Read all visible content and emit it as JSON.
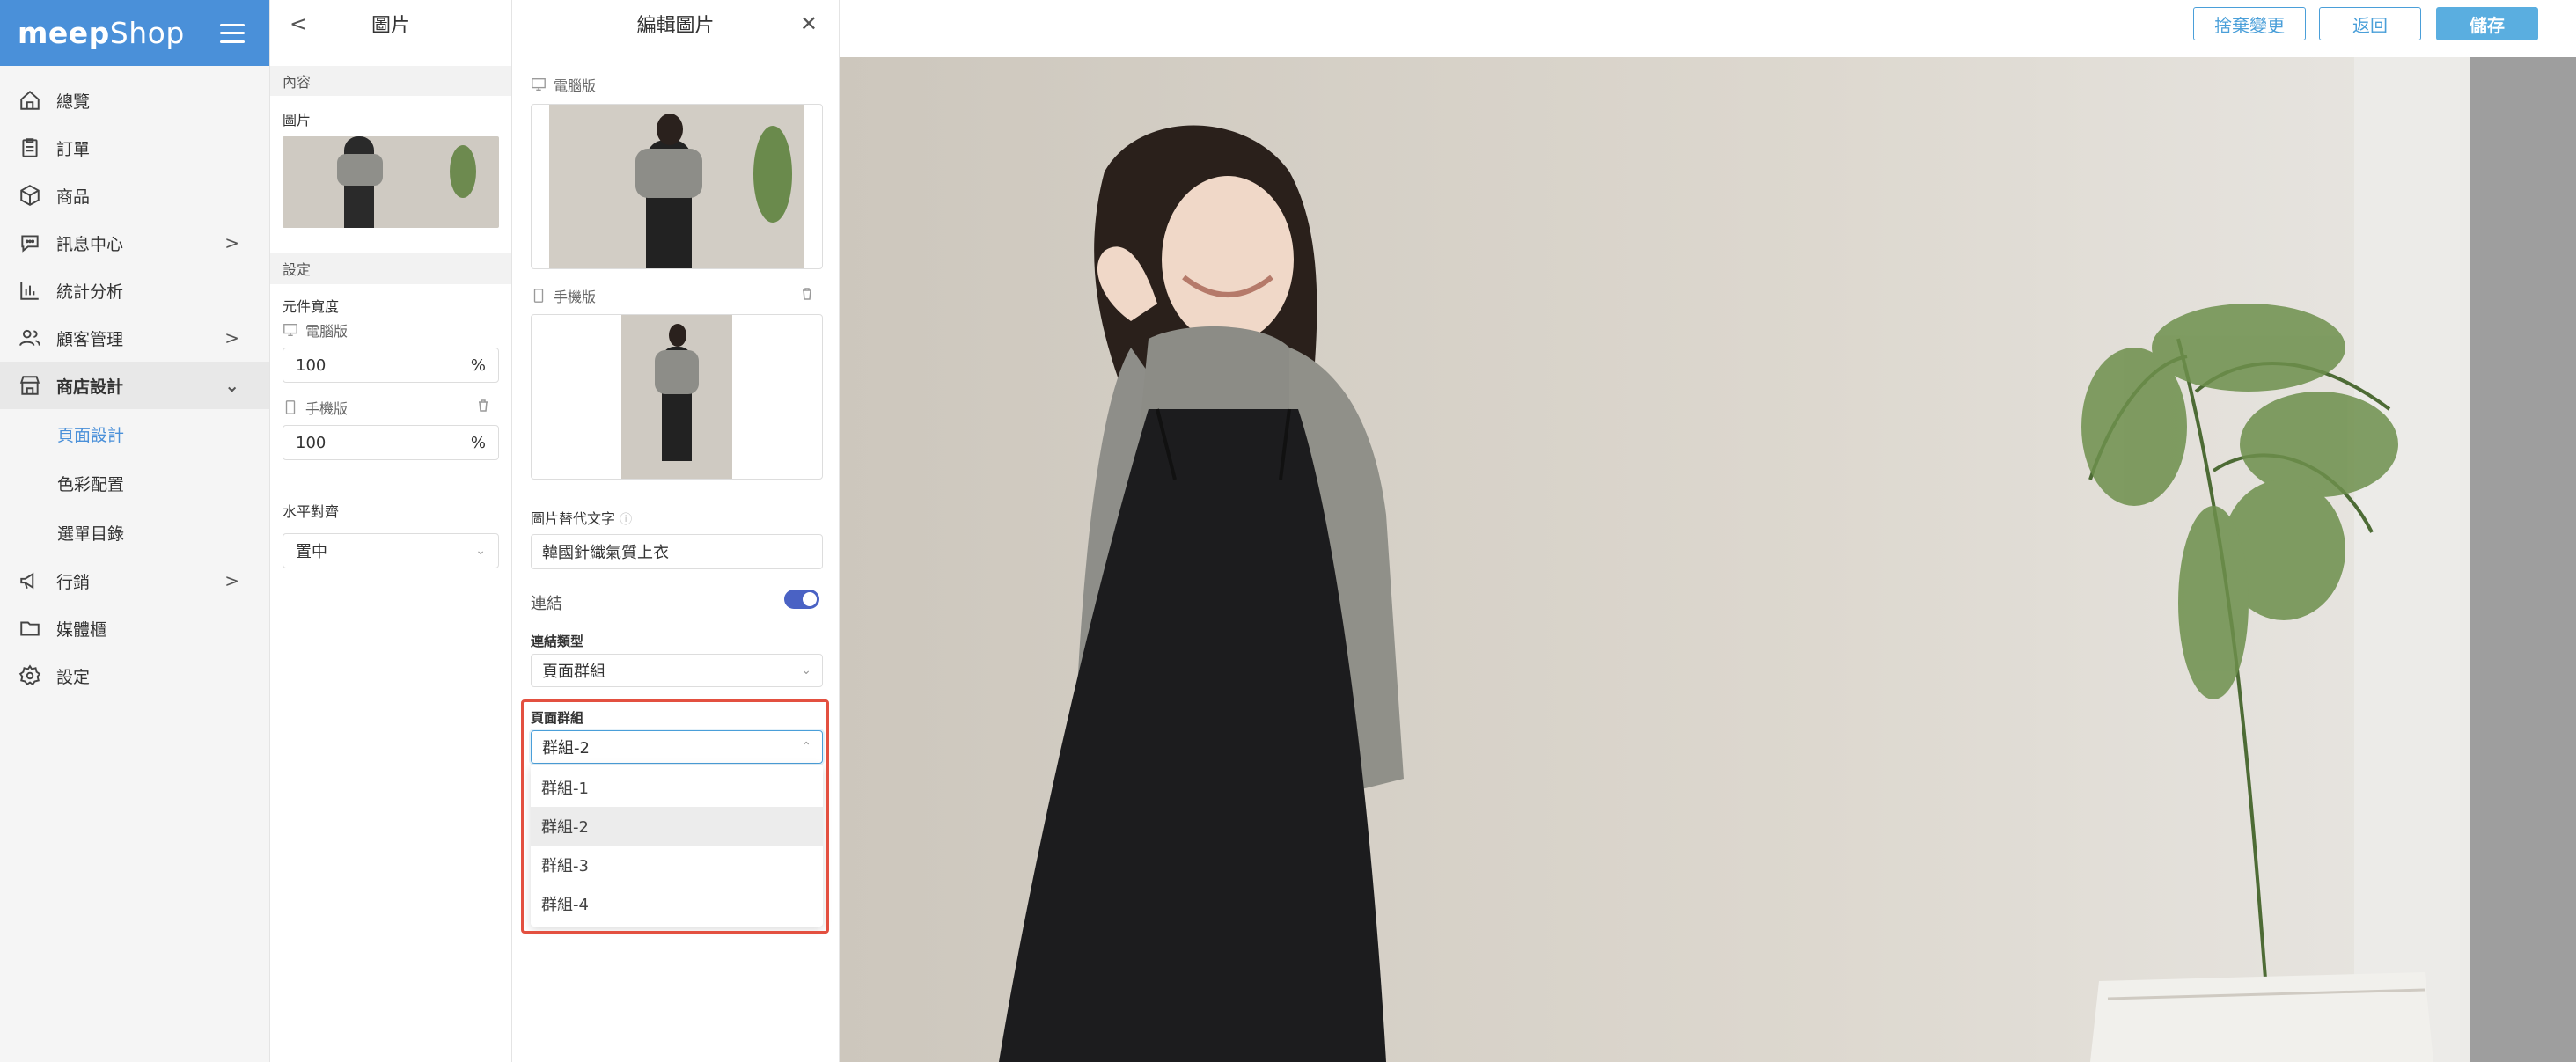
{
  "sidebar": {
    "brand_bold": "meep",
    "brand_light": "Shop",
    "items": [
      {
        "label": "總覽",
        "icon": "home-icon"
      },
      {
        "label": "訂單",
        "icon": "clipboard-icon"
      },
      {
        "label": "商品",
        "icon": "box-icon"
      },
      {
        "label": "訊息中心",
        "icon": "chat-icon",
        "chevron": ">"
      },
      {
        "label": "統計分析",
        "icon": "bar-chart-icon"
      },
      {
        "label": "顧客管理",
        "icon": "users-icon",
        "chevron": ">"
      },
      {
        "label": "商店設計",
        "icon": "store-icon",
        "chevron": "⌄"
      },
      {
        "label": "行銷",
        "icon": "megaphone-icon",
        "chevron": ">"
      },
      {
        "label": "媒體櫃",
        "icon": "folder-icon"
      },
      {
        "label": "設定",
        "icon": "gear-icon"
      }
    ],
    "sub_items": [
      "頁面設計",
      "色彩配置",
      "選單目錄"
    ]
  },
  "props": {
    "title": "圖片",
    "content_section": "內容",
    "image_label": "圖片",
    "settings_section": "設定",
    "width_label": "元件寬度",
    "desktop_label": "電腦版",
    "desktop_value": "100",
    "mobile_label": "手機版",
    "mobile_value": "100",
    "percent": "%",
    "align_label": "水平對齊",
    "align_value": "置中"
  },
  "edit": {
    "title": "編輯圖片",
    "desktop_label": "電腦版",
    "mobile_label": "手機版",
    "alt_label": "圖片替代文字",
    "alt_value": "韓國針織氣質上衣",
    "link_label": "連結",
    "link_enabled": true,
    "link_type_label": "連結類型",
    "link_type_value": "頁面群組",
    "group_label": "頁面群組",
    "group_value": "群組-2",
    "group_options": [
      "群組-1",
      "群組-2",
      "群組-3",
      "群組-4"
    ]
  },
  "topbar": {
    "discard_label": "捨棄變更",
    "back_label": "返回",
    "save_label": "儲存"
  },
  "colors": {
    "brand": "#4a90d9",
    "accent": "#4a9fd9",
    "highlight": "#e35040",
    "toggle": "#4a62c4"
  }
}
